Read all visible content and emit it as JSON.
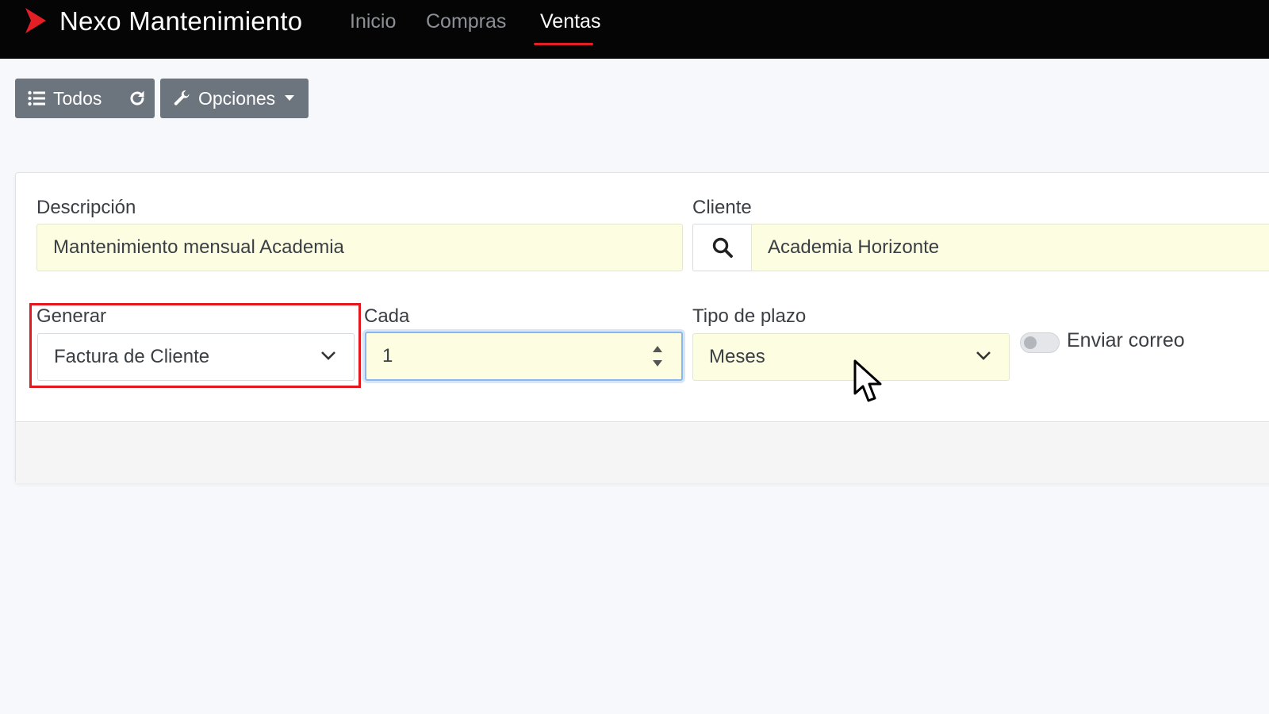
{
  "app": {
    "title": "Nexo Mantenimiento",
    "brand_color": "#e31e24"
  },
  "nav": {
    "items": [
      {
        "label": "Inicio",
        "active": false
      },
      {
        "label": "Compras",
        "active": false
      },
      {
        "label": "Ventas",
        "active": true
      }
    ]
  },
  "toolbar": {
    "todos_label": "Todos",
    "opciones_label": "Opciones",
    "icons": [
      "list-icon",
      "reload-icon",
      "wrench-icon",
      "caret-down-icon"
    ]
  },
  "form": {
    "descripcion": {
      "label": "Descripción",
      "value": "Mantenimiento mensual Academia"
    },
    "cliente": {
      "label": "Cliente",
      "value": "Academia Horizonte"
    },
    "generar": {
      "label": "Generar",
      "value": "Factura de Cliente"
    },
    "cada": {
      "label": "Cada",
      "value": "1"
    },
    "tipo_plazo": {
      "label": "Tipo de plazo",
      "value": "Meses"
    },
    "enviar_correo": {
      "label": "Enviar correo",
      "enabled": false
    }
  },
  "colors": {
    "navbar_bg": "#050505",
    "button_bg": "#6c757d",
    "field_bg": "#fdfde1",
    "highlight": "#e3181f",
    "focus": "#8bb5ee"
  }
}
